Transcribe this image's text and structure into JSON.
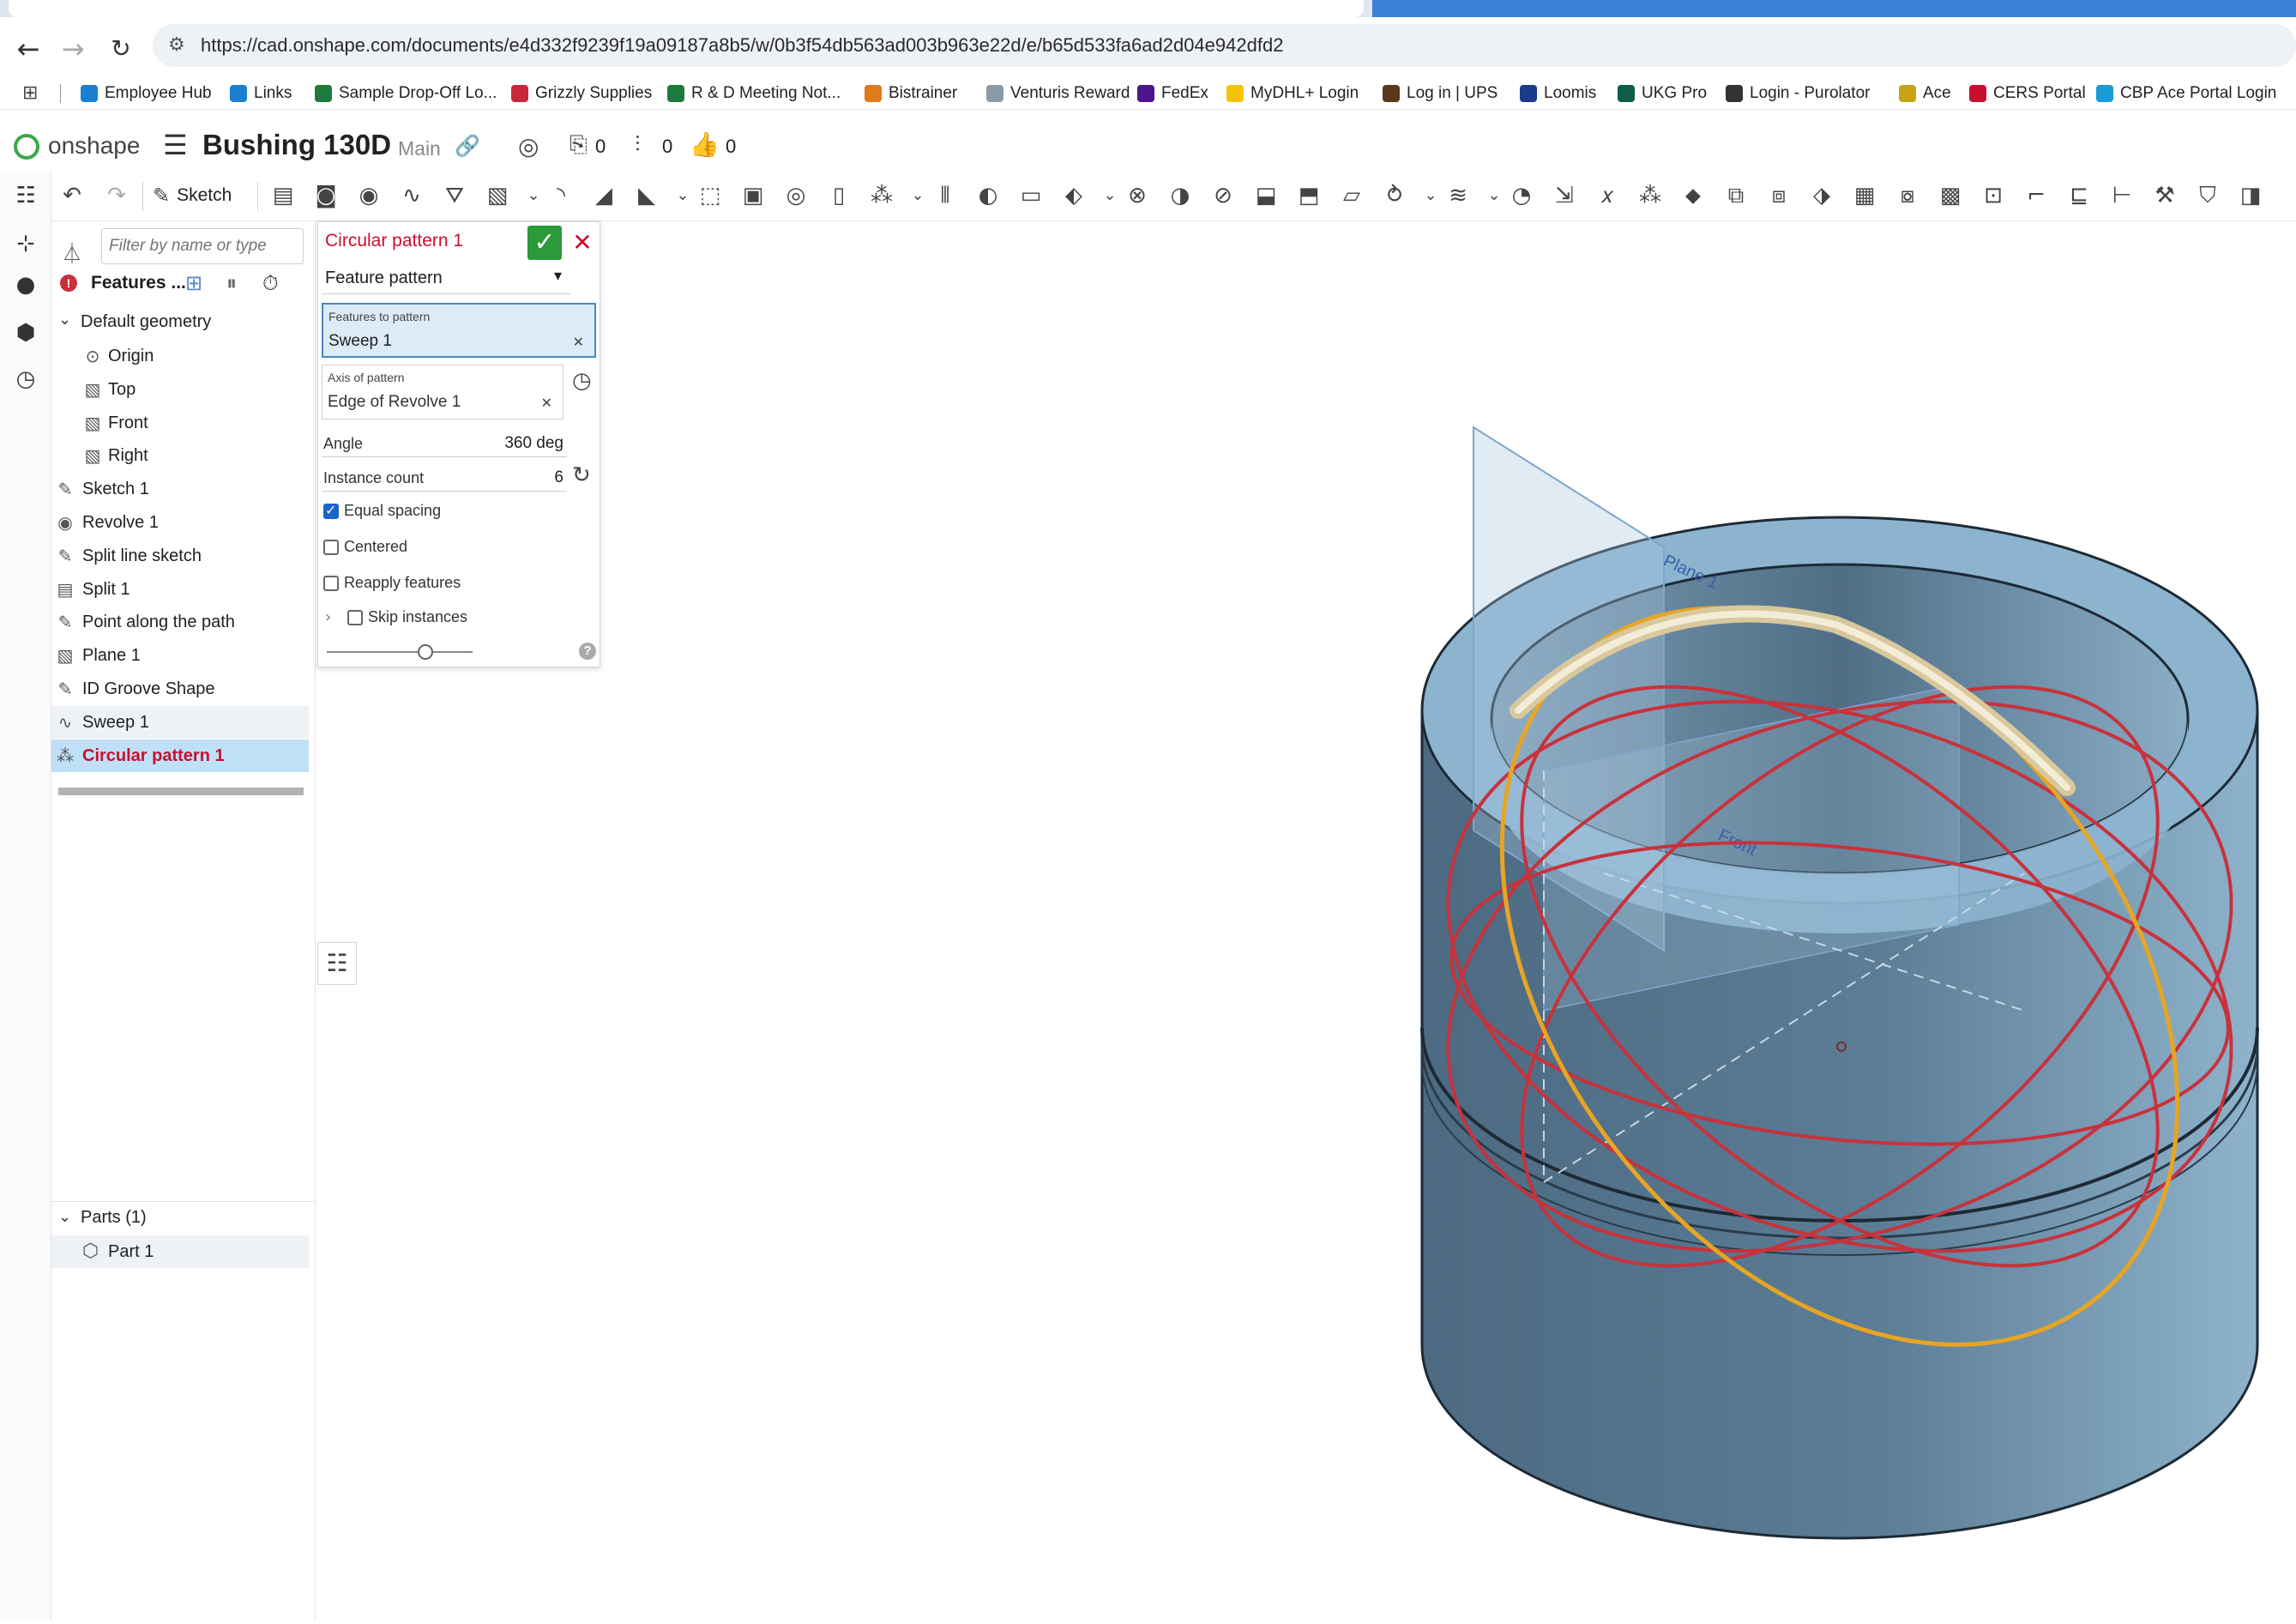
{
  "browser": {
    "url": "https://cad.onshape.com/documents/e4d332f9239f19a09187a8b5/w/0b3f54db563ad003b963e22d/e/b65d533fa6ad2d04e942dfd2",
    "bookmarks": [
      {
        "label": "Employee Hub",
        "color": "#1a7fd1"
      },
      {
        "label": "Links",
        "color": "#1a7fd1"
      },
      {
        "label": "Sample Drop-Off Lo...",
        "color": "#1e7a3c"
      },
      {
        "label": "Grizzly Supplies",
        "color": "#c8283c"
      },
      {
        "label": "R & D Meeting Not...",
        "color": "#1e7a3c"
      },
      {
        "label": "Bistrainer",
        "color": "#e07a1a"
      },
      {
        "label": "Venturis Reward",
        "color": "#8a9aa8"
      },
      {
        "label": "FedEx",
        "color": "#4d148c"
      },
      {
        "label": "MyDHL+ Login",
        "color": "#f5c400"
      },
      {
        "label": "Log in | UPS",
        "color": "#5a3a1a"
      },
      {
        "label": "Loomis",
        "color": "#1a3a8a"
      },
      {
        "label": "UKG Pro",
        "color": "#0e5c4a"
      },
      {
        "label": "Login - Purolator",
        "color": "#333333"
      },
      {
        "label": "Ace",
        "color": "#c8a414"
      },
      {
        "label": "CERS Portal",
        "color": "#c8102e"
      },
      {
        "label": "CBP Ace Portal Login",
        "color": "#1a9ad6"
      }
    ]
  },
  "app": {
    "brand": "onshape",
    "document_title": "Bushing 130D",
    "branch": "Main",
    "counters": [
      "0",
      "0",
      "0"
    ],
    "sketch_label": "Sketch"
  },
  "tree": {
    "filter_placeholder": "Filter by name or type",
    "features_label": "Features ...",
    "default_geometry": "Default geometry",
    "items": [
      {
        "label": "Origin",
        "indent": true
      },
      {
        "label": "Top",
        "indent": true
      },
      {
        "label": "Front",
        "indent": true
      },
      {
        "label": "Right",
        "indent": true
      },
      {
        "label": "Sketch 1"
      },
      {
        "label": "Revolve 1"
      },
      {
        "label": "Split line sketch"
      },
      {
        "label": "Split 1"
      },
      {
        "label": "Point along the path"
      },
      {
        "label": "Plane 1"
      },
      {
        "label": "ID Groove Shape"
      },
      {
        "label": "Sweep 1"
      },
      {
        "label": "Circular pattern 1"
      }
    ],
    "parts_header": "Parts (1)",
    "parts": [
      "Part 1"
    ]
  },
  "dialog": {
    "title": "Circular pattern 1",
    "pattern_type": "Feature pattern",
    "features_label": "Features to pattern",
    "features_value": "Sweep 1",
    "axis_label": "Axis of pattern",
    "axis_value": "Edge of Revolve 1",
    "angle_label": "Angle",
    "angle_value": "360 deg",
    "count_label": "Instance count",
    "count_value": "6",
    "equal_spacing": "Equal spacing",
    "centered": "Centered",
    "reapply": "Reapply features",
    "skip": "Skip instances",
    "equal_spacing_checked": true,
    "help": "?"
  },
  "viewport": {
    "plane_label": "Plane 1",
    "front_label": "Front",
    "colors": {
      "body": "#5a7a92",
      "top_face": "#8cb4cf",
      "sweep_path": "#e8a423",
      "pattern_paths": "#c8323c"
    }
  }
}
